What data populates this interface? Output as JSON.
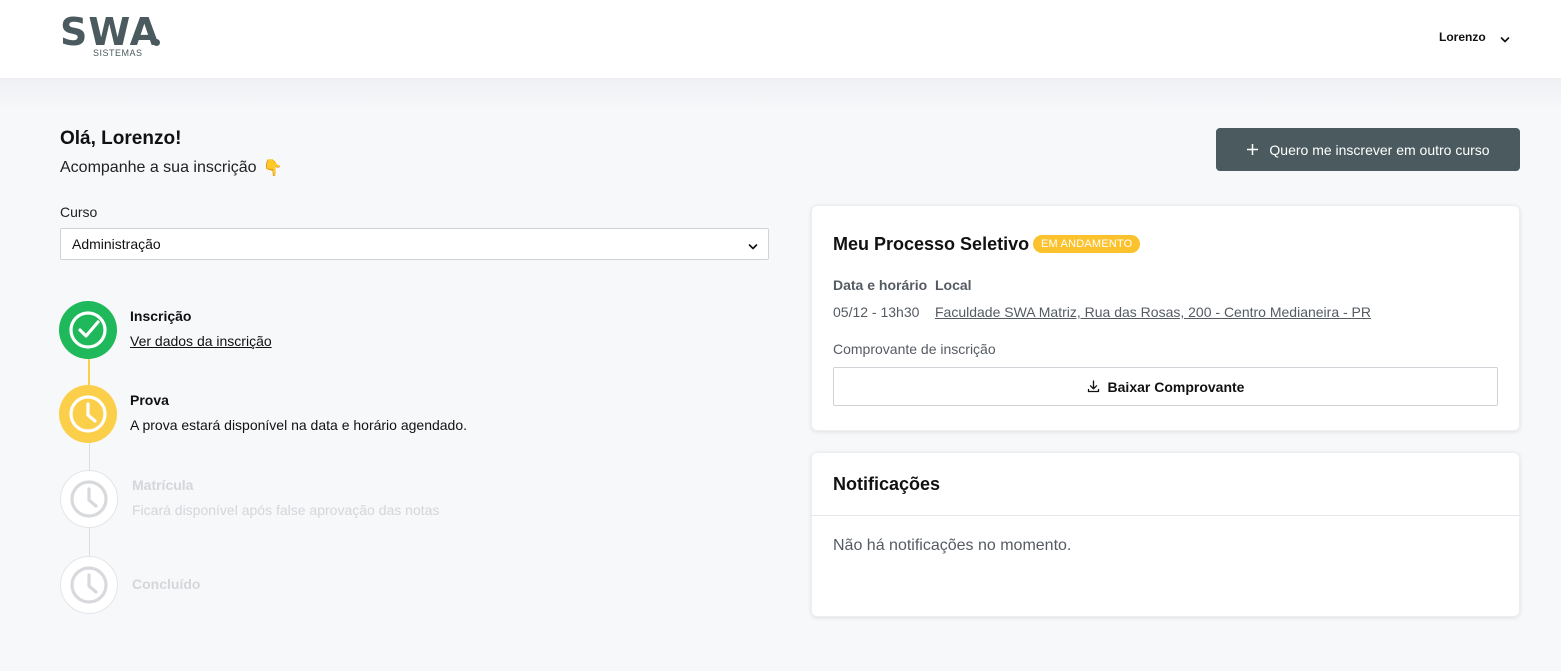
{
  "header": {
    "logo_text": "SWA",
    "logo_sub": "SISTEMAS",
    "user_name": "Lorenzo"
  },
  "greeting": {
    "title": "Olá, Lorenzo!",
    "subtitle": "Acompanhe a sua inscrição",
    "emoji": "👇"
  },
  "actions": {
    "new_course_label": "Quero me inscrever em outro curso"
  },
  "course": {
    "label": "Curso",
    "selected": "Administração"
  },
  "steps": [
    {
      "title": "Inscrição",
      "link": "Ver dados da inscrição",
      "status": "done"
    },
    {
      "title": "Prova",
      "desc": "A prova estará disponível na data e horário agendado.",
      "status": "current"
    },
    {
      "title": "Matrícula",
      "desc": "Ficará disponível após false aprovação das notas",
      "status": "pending"
    },
    {
      "title": "Concluído",
      "status": "pending"
    }
  ],
  "process": {
    "title": "Meu Processo Seletivo",
    "badge": "EM ANDAMENTO",
    "date_head": "Data e horário",
    "local_head": "Local",
    "date_value": "05/12 - 13h30",
    "local_value": "Faculdade SWA Matriz, Rua das Rosas, 200 - Centro Medianeira - PR",
    "receipt_label": "Comprovante de inscrição",
    "download_label": "Baixar Comprovante"
  },
  "notifications": {
    "title": "Notificações",
    "empty": "Não há notificações no momento."
  },
  "colors": {
    "brand": "#4a5a5e",
    "done": "#1fb85a",
    "current": "#fbcf4a",
    "pending": "#d7d9dc",
    "badge": "#fbc22d"
  }
}
